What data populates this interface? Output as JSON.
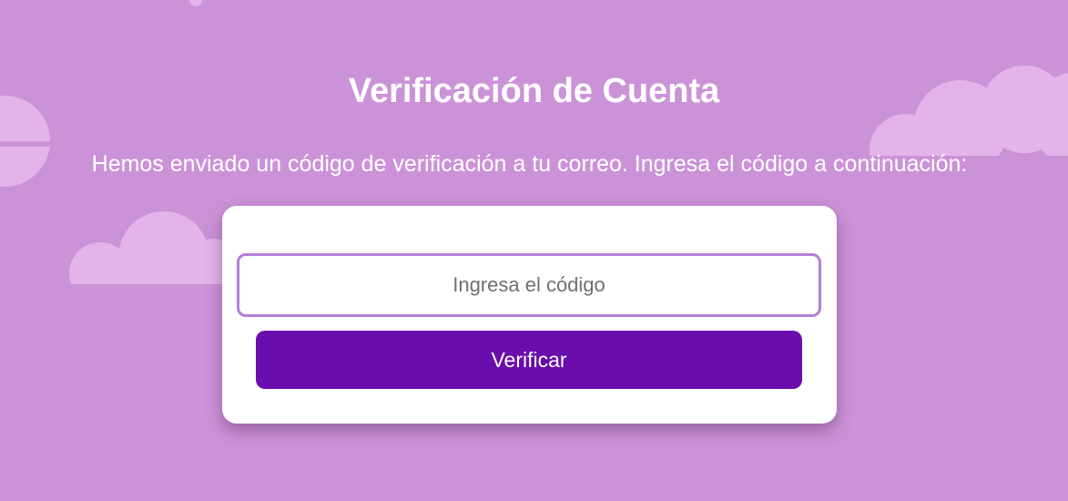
{
  "page": {
    "title": "Verificación de Cuenta",
    "subtitle": "Hemos enviado un código de verificación a tu correo. Ingresa el código a continuación:"
  },
  "form": {
    "code_placeholder": "Ingresa el código",
    "code_value": "",
    "verify_label": "Verificar"
  },
  "colors": {
    "background": "#cc92d8",
    "cloud": "#e3b3ea",
    "card": "#ffffff",
    "input_border": "#b57ed6",
    "button": "#6a0dad",
    "button_text": "#ffffff"
  },
  "decorations": {
    "icons": [
      "cloud-icon"
    ]
  }
}
